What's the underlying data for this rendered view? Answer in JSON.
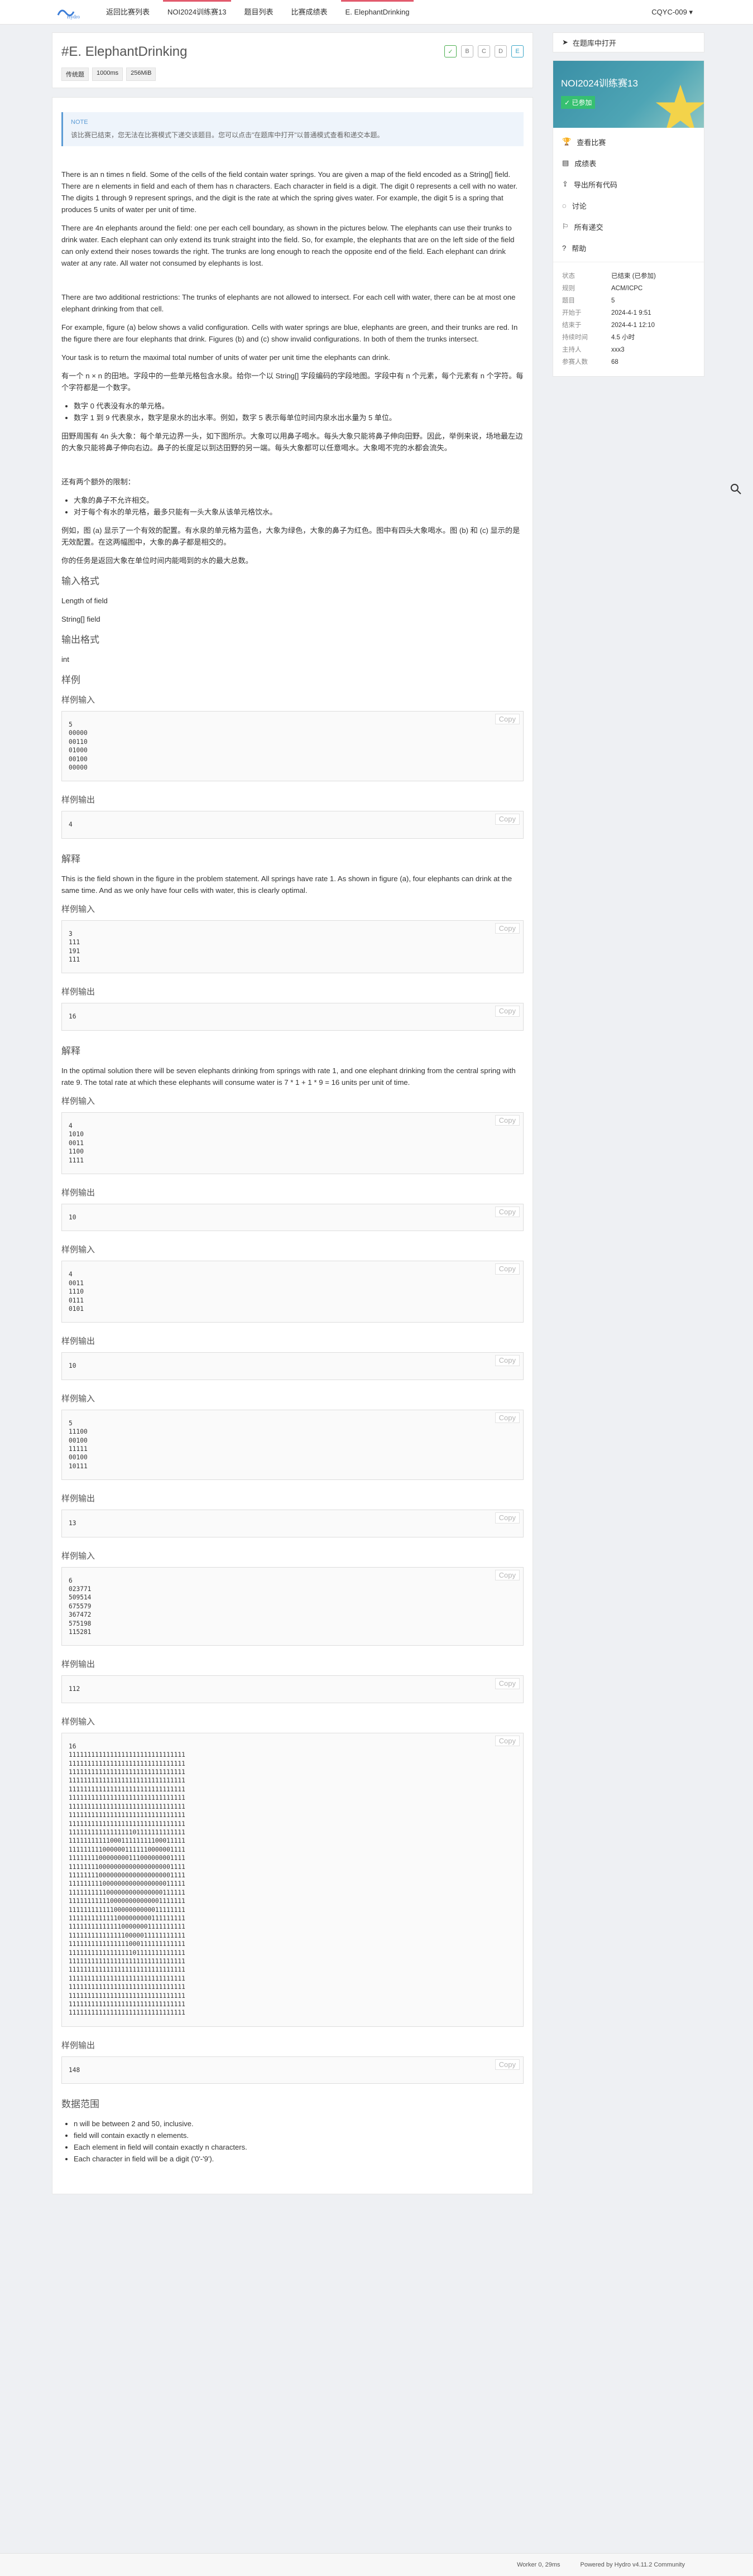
{
  "nav": {
    "logo": "Hydro",
    "items": [
      "返回比赛列表",
      "NOI2024训练赛13",
      "题目列表",
      "比赛成绩表",
      "E. ElephantDrinking"
    ],
    "user": "CQYC-009 ▾"
  },
  "problem": {
    "title": "#E. ElephantDrinking",
    "chips": [
      "✓",
      "B",
      "C",
      "D",
      "E"
    ],
    "tags": [
      "传统题",
      "1000ms",
      "256MiB"
    ]
  },
  "note": {
    "title": "NOTE",
    "text": "该比赛已结束，您无法在比赛模式下递交该题目。您可以点击\"在题库中打开\"以普通模式查看和递交本题。"
  },
  "statement_en": [
    "There is an n times n field. Some of the cells of the field contain water springs. You are given a map of the field encoded as a String[] field. There are n elements in field and each of them has n characters. Each character in field is a digit. The digit 0 represents a cell with no water. The digits 1 through 9 represent springs, and the digit is the rate at which the spring gives water. For example, the digit 5 is a spring that produces 5 units of water per unit of time.",
    "There are 4n elephants around the field: one per each cell boundary, as shown in the pictures below. The elephants can use their trunks to drink water. Each elephant can only extend its trunk straight into the field. So, for example, the elephants that are on the left side of the field can only extend their noses towards the right. The trunks are long enough to reach the opposite end of the field. Each elephant can drink water at any rate. All water not consumed by elephants is lost.",
    "There are two additional restrictions: The trunks of elephants are not allowed to intersect. For each cell with water, there can be at most one elephant drinking from that cell.",
    "For example, figure (a) below shows a valid configuration. Cells with water springs are blue, elephants are green, and their trunks are red. In the figure there are four elephants that drink. Figures (b) and (c) show invalid configurations. In both of them the trunks intersect.",
    "Your task is to return the maximal total number of units of water per unit time the elephants can drink."
  ],
  "statement_cn": [
    "有一个 n × n 的田地。字段中的一些单元格包含水泉。给你一个以 String[] 字段编码的字段地图。字段中有 n 个元素，每个元素有 n 个字符。每个字符都是一个数字。",
    "数字 0 代表没有水的单元格。",
    "数字 1 到 9 代表泉水，数字是泉水的出水率。例如，数字 5 表示每单位时间内泉水出水量为 5 单位。",
    "田野周围有 4n 头大象：每个单元边界一头，如下图所示。大象可以用鼻子喝水。每头大象只能将鼻子伸向田野。因此，举例来说，场地最左边的大象只能将鼻子伸向右边。鼻子的长度足以到达田野的另一端。每头大象都可以任意喝水。大象喝不完的水都会流失。",
    "还有两个额外的限制：",
    "大象的鼻子不允许相交。",
    "对于每个有水的单元格，最多只能有一头大象从该单元格饮水。",
    "例如，图 (a) 显示了一个有效的配置。有水泉的单元格为蓝色，大象为绿色，大象的鼻子为红色。图中有四头大象喝水。图 (b) 和 (c) 显示的是无效配置。在这两幅图中，大象的鼻子都是相交的。",
    "你的任务是返回大象在单位时间内能喝到的水的最大总数。"
  ],
  "io": {
    "input_title": "输入格式",
    "input_lines": [
      "Length of field",
      "String[] field"
    ],
    "output_title": "输出格式",
    "output_line": "int",
    "samples_title": "样例"
  },
  "labels": {
    "in": "样例输入",
    "out": "样例输出",
    "explain": "解释",
    "copy": "Copy"
  },
  "samples": [
    {
      "input": "5\n00000\n00110\n01000\n00100\n00000",
      "output": "4",
      "explain": "This is the field shown in the figure in the problem statement. All springs have rate 1. As shown in figure (a), four elephants can drink at the same time. And as we only have four cells with water, this is clearly optimal."
    },
    {
      "input": "3\n111\n191\n111",
      "output": "16",
      "explain": "In the optimal solution there will be seven elephants drinking from springs with rate 1, and one elephant drinking from the central spring with rate 9. The total rate at which these elephants will consume water is 7 * 1 + 1 * 9 = 16 units per unit of time."
    },
    {
      "input": "4\n1010\n0011\n1100\n1111",
      "output": "10",
      "explain": ""
    },
    {
      "input": "4\n0011\n1110\n0111\n0101",
      "output": "10",
      "explain": ""
    },
    {
      "input": "5\n11100\n00100\n11111\n00100\n10111",
      "output": "13",
      "explain": ""
    },
    {
      "input": "6\n023771\n509514\n675579\n367472\n575198\n115281",
      "output": "112",
      "explain": ""
    },
    {
      "input": "16\n1111111111111111111111111111111\n1111111111111111111111111111111\n1111111111111111111111111111111\n1111111111111111111111111111111\n1111111111111111111111111111111\n1111111111111111111111111111111\n1111111111111111111111111111111\n1111111111111111111111111111111\n1111111111111111111111111111111\n1111111111111111101111111111111\n1111111111100011111111100011111\n1111111110000001111110000001111\n1111111100000000111000000001111\n1111111100000000000000000001111\n1111111100000000000000000001111\n1111111110000000000000000011111\n1111111111000000000000000111111\n1111111111100000000000001111111\n1111111111110000000000011111111\n1111111111111000000000111111111\n1111111111111100000001111111111\n1111111111111110000011111111111\n1111111111111111000111111111111\n1111111111111111101111111111111\n1111111111111111111111111111111\n1111111111111111111111111111111\n1111111111111111111111111111111\n1111111111111111111111111111111\n1111111111111111111111111111111\n1111111111111111111111111111111\n1111111111111111111111111111111",
      "output": "148",
      "explain": ""
    }
  ],
  "range": {
    "title": "数据范围",
    "items": [
      "n will be between 2 and 50, inclusive.",
      "field will contain exactly n elements.",
      "Each element in field will contain exactly n characters.",
      "Each character in field will be a digit ('0'-'9')."
    ]
  },
  "sidebar": {
    "open_label": "在题库中打开",
    "banner_title": "NOI2024训练赛13",
    "banner_joined": "✓ 已参加",
    "menu": [
      "查看比赛",
      "成绩表",
      "导出所有代码",
      "讨论",
      "所有递交",
      "帮助"
    ],
    "info": [
      {
        "k": "状态",
        "v": "已结束 (已参加)"
      },
      {
        "k": "规则",
        "v": "ACM/ICPC"
      },
      {
        "k": "题目",
        "v": "5"
      },
      {
        "k": "开始于",
        "v": "2024-4-1 9:51"
      },
      {
        "k": "结束于",
        "v": "2024-4-1 12:10"
      },
      {
        "k": "持续时间",
        "v": "4.5 小时"
      },
      {
        "k": "主持人",
        "v": "xxx3"
      },
      {
        "k": "参赛人数",
        "v": "68"
      }
    ]
  },
  "footer": {
    "left": "Worker 0, 29ms",
    "right": "Powered by Hydro v4.11.2 Community"
  }
}
